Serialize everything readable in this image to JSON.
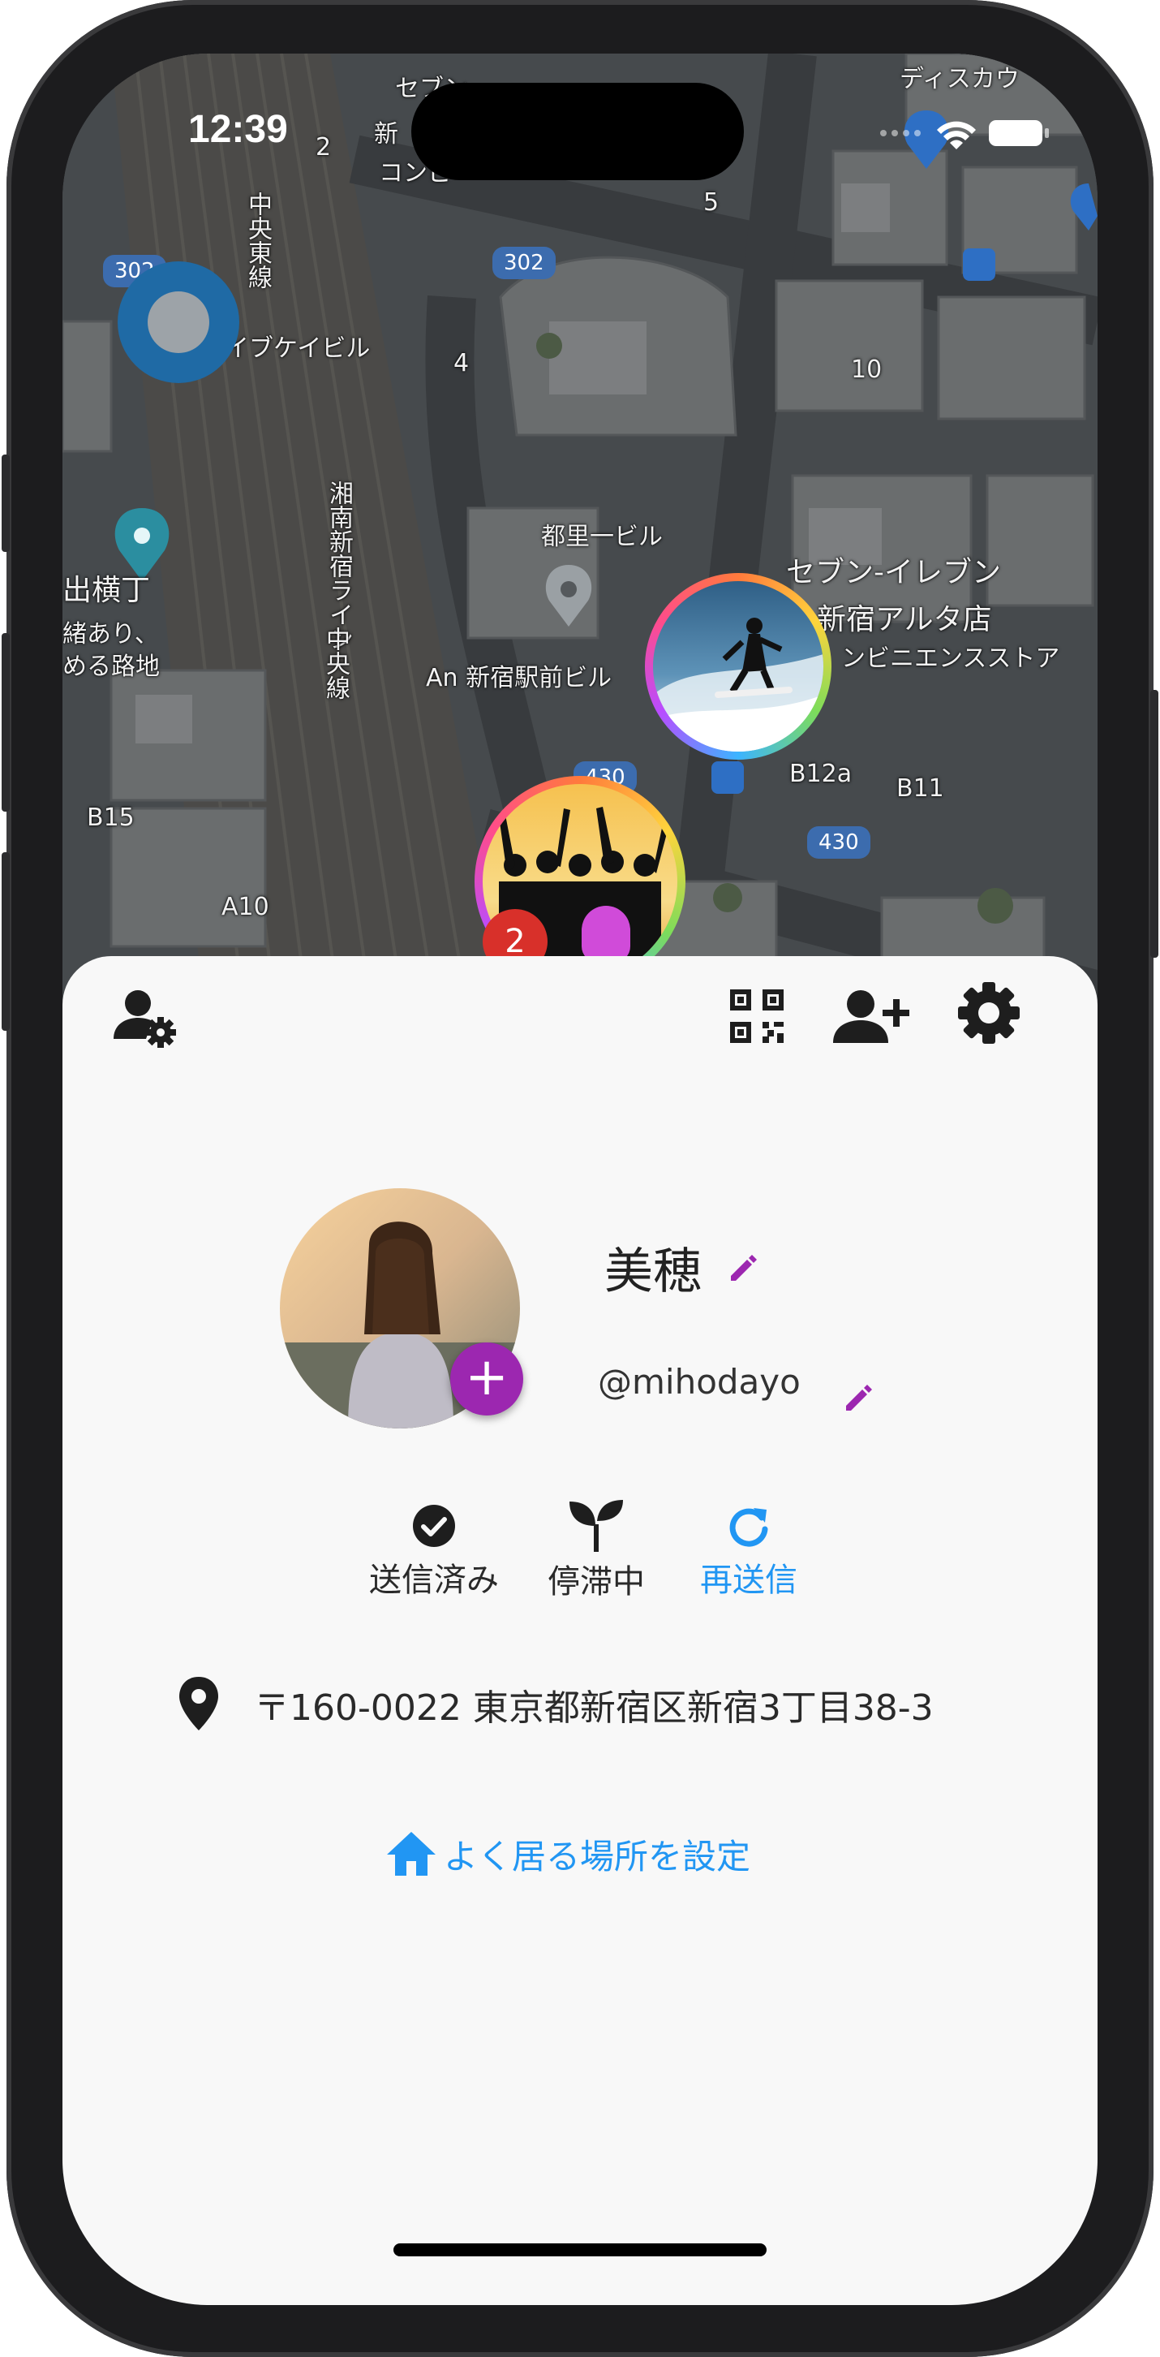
{
  "status_bar": {
    "time": "12:39",
    "wifi_icon": "wifi-icon",
    "battery_icon": "battery-icon"
  },
  "map": {
    "labels": {
      "train_line_chuo_east": "中央東線",
      "building_ibukei": "イブケイビル",
      "alley_left_1": "出横丁",
      "alley_left_2": "緒あり、",
      "alley_left_3": "める路地",
      "miyako_building": "都里一ビル",
      "shonan_line": "湘南新宿ライン",
      "chuo_line": "中央線",
      "an_building": "An 新宿駅前ビル",
      "seven_eleven_1": "セブン-イレブン",
      "seven_eleven_2": "新宿アルタ店",
      "convenience": "ンビニエンスストア",
      "top_seven": "セブン",
      "top_discount": "ディスカウ",
      "top_convenience": "コンビ",
      "top_new": "新",
      "exit_b12a": "B12a",
      "exit_b11": "B11",
      "exit_b15": "B15",
      "exit_a10": "A10",
      "num_10": "10",
      "num_5": "5",
      "num_4": "4",
      "num_2": "2"
    },
    "road_badges": {
      "r302_left": "302",
      "r302_center": "302",
      "r430_top": "430",
      "r430_right": "430"
    },
    "friend_group_count": "2"
  },
  "sheet": {
    "toolbar": {
      "account_settings_icon": "account-settings-icon",
      "qr_icon": "qr-code-icon",
      "add_friend_icon": "add-friend-icon",
      "settings_icon": "gear-icon"
    },
    "profile": {
      "name": "美穂",
      "handle": "@mihodayo",
      "add_photo_label": "+"
    },
    "status_actions": [
      {
        "label": "送信済み",
        "icon": "check-circle-icon"
      },
      {
        "label": "停滞中",
        "icon": "sprout-icon"
      },
      {
        "label": "再送信",
        "icon": "refresh-icon"
      }
    ],
    "address": "〒160-0022 東京都新宿区新宿3丁目38-3",
    "home_link": "よく居る場所を設定"
  },
  "colors": {
    "accent_purple": "#9c27b0",
    "link_blue": "#2196f3",
    "sheet_bg": "#f8f8f8",
    "location_blue": "#1f6aa5"
  }
}
